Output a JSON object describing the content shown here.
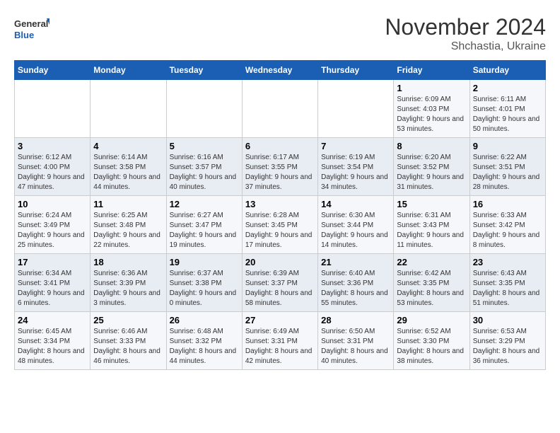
{
  "logo": {
    "line1": "General",
    "line2": "Blue"
  },
  "title": "November 2024",
  "subtitle": "Shchastia, Ukraine",
  "weekdays": [
    "Sunday",
    "Monday",
    "Tuesday",
    "Wednesday",
    "Thursday",
    "Friday",
    "Saturday"
  ],
  "weeks": [
    [
      {
        "day": "",
        "info": ""
      },
      {
        "day": "",
        "info": ""
      },
      {
        "day": "",
        "info": ""
      },
      {
        "day": "",
        "info": ""
      },
      {
        "day": "",
        "info": ""
      },
      {
        "day": "1",
        "info": "Sunrise: 6:09 AM\nSunset: 4:03 PM\nDaylight: 9 hours and 53 minutes."
      },
      {
        "day": "2",
        "info": "Sunrise: 6:11 AM\nSunset: 4:01 PM\nDaylight: 9 hours and 50 minutes."
      }
    ],
    [
      {
        "day": "3",
        "info": "Sunrise: 6:12 AM\nSunset: 4:00 PM\nDaylight: 9 hours and 47 minutes."
      },
      {
        "day": "4",
        "info": "Sunrise: 6:14 AM\nSunset: 3:58 PM\nDaylight: 9 hours and 44 minutes."
      },
      {
        "day": "5",
        "info": "Sunrise: 6:16 AM\nSunset: 3:57 PM\nDaylight: 9 hours and 40 minutes."
      },
      {
        "day": "6",
        "info": "Sunrise: 6:17 AM\nSunset: 3:55 PM\nDaylight: 9 hours and 37 minutes."
      },
      {
        "day": "7",
        "info": "Sunrise: 6:19 AM\nSunset: 3:54 PM\nDaylight: 9 hours and 34 minutes."
      },
      {
        "day": "8",
        "info": "Sunrise: 6:20 AM\nSunset: 3:52 PM\nDaylight: 9 hours and 31 minutes."
      },
      {
        "day": "9",
        "info": "Sunrise: 6:22 AM\nSunset: 3:51 PM\nDaylight: 9 hours and 28 minutes."
      }
    ],
    [
      {
        "day": "10",
        "info": "Sunrise: 6:24 AM\nSunset: 3:49 PM\nDaylight: 9 hours and 25 minutes."
      },
      {
        "day": "11",
        "info": "Sunrise: 6:25 AM\nSunset: 3:48 PM\nDaylight: 9 hours and 22 minutes."
      },
      {
        "day": "12",
        "info": "Sunrise: 6:27 AM\nSunset: 3:47 PM\nDaylight: 9 hours and 19 minutes."
      },
      {
        "day": "13",
        "info": "Sunrise: 6:28 AM\nSunset: 3:45 PM\nDaylight: 9 hours and 17 minutes."
      },
      {
        "day": "14",
        "info": "Sunrise: 6:30 AM\nSunset: 3:44 PM\nDaylight: 9 hours and 14 minutes."
      },
      {
        "day": "15",
        "info": "Sunrise: 6:31 AM\nSunset: 3:43 PM\nDaylight: 9 hours and 11 minutes."
      },
      {
        "day": "16",
        "info": "Sunrise: 6:33 AM\nSunset: 3:42 PM\nDaylight: 9 hours and 8 minutes."
      }
    ],
    [
      {
        "day": "17",
        "info": "Sunrise: 6:34 AM\nSunset: 3:41 PM\nDaylight: 9 hours and 6 minutes."
      },
      {
        "day": "18",
        "info": "Sunrise: 6:36 AM\nSunset: 3:39 PM\nDaylight: 9 hours and 3 minutes."
      },
      {
        "day": "19",
        "info": "Sunrise: 6:37 AM\nSunset: 3:38 PM\nDaylight: 9 hours and 0 minutes."
      },
      {
        "day": "20",
        "info": "Sunrise: 6:39 AM\nSunset: 3:37 PM\nDaylight: 8 hours and 58 minutes."
      },
      {
        "day": "21",
        "info": "Sunrise: 6:40 AM\nSunset: 3:36 PM\nDaylight: 8 hours and 55 minutes."
      },
      {
        "day": "22",
        "info": "Sunrise: 6:42 AM\nSunset: 3:35 PM\nDaylight: 8 hours and 53 minutes."
      },
      {
        "day": "23",
        "info": "Sunrise: 6:43 AM\nSunset: 3:35 PM\nDaylight: 8 hours and 51 minutes."
      }
    ],
    [
      {
        "day": "24",
        "info": "Sunrise: 6:45 AM\nSunset: 3:34 PM\nDaylight: 8 hours and 48 minutes."
      },
      {
        "day": "25",
        "info": "Sunrise: 6:46 AM\nSunset: 3:33 PM\nDaylight: 8 hours and 46 minutes."
      },
      {
        "day": "26",
        "info": "Sunrise: 6:48 AM\nSunset: 3:32 PM\nDaylight: 8 hours and 44 minutes."
      },
      {
        "day": "27",
        "info": "Sunrise: 6:49 AM\nSunset: 3:31 PM\nDaylight: 8 hours and 42 minutes."
      },
      {
        "day": "28",
        "info": "Sunrise: 6:50 AM\nSunset: 3:31 PM\nDaylight: 8 hours and 40 minutes."
      },
      {
        "day": "29",
        "info": "Sunrise: 6:52 AM\nSunset: 3:30 PM\nDaylight: 8 hours and 38 minutes."
      },
      {
        "day": "30",
        "info": "Sunrise: 6:53 AM\nSunset: 3:29 PM\nDaylight: 8 hours and 36 minutes."
      }
    ]
  ]
}
